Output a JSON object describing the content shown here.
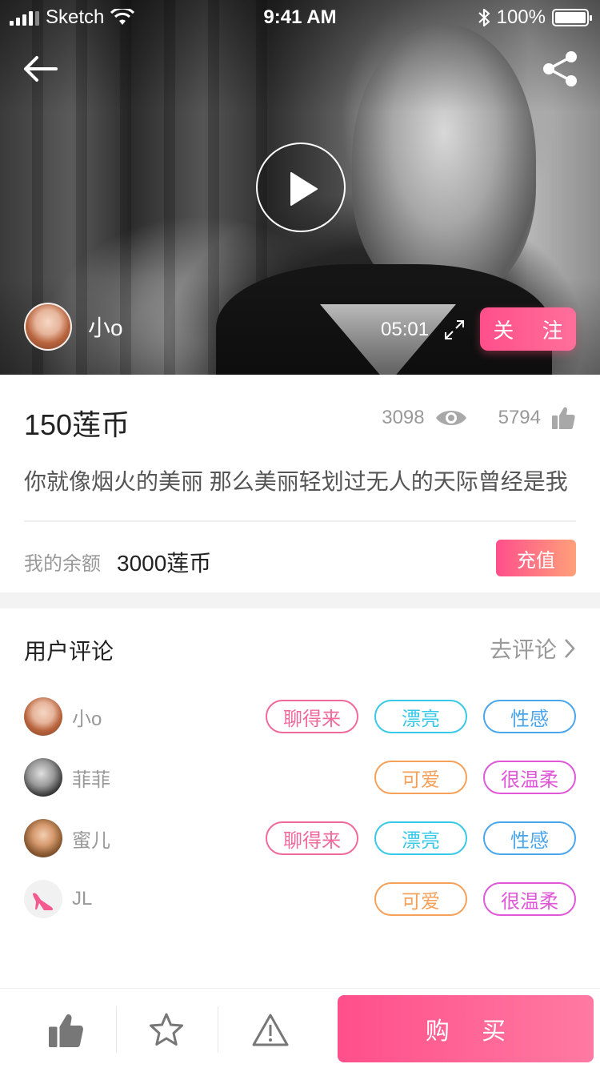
{
  "status_bar": {
    "carrier": "Sketch",
    "time": "9:41 AM",
    "battery_text": "100%"
  },
  "video": {
    "author_name": "小o",
    "duration": "05:01",
    "follow_label": "关 注"
  },
  "product": {
    "price": "150莲币",
    "views": "3098",
    "likes": "5794",
    "description": "你就像烟火的美丽 那么美丽轻划过无人的天际曾经是我"
  },
  "balance": {
    "label": "我的余额",
    "value": "3000莲币",
    "recharge_label": "充值"
  },
  "comments": {
    "title": "用户评论",
    "go_comment_label": "去评论",
    "items": [
      {
        "name": "小o",
        "tags": [
          "聊得来",
          "漂亮",
          "性感"
        ]
      },
      {
        "name": "菲菲",
        "tags": [
          "可爱",
          "很温柔"
        ]
      },
      {
        "name": "蜜儿",
        "tags": [
          "聊得来",
          "漂亮",
          "性感"
        ]
      },
      {
        "name": "JL",
        "tags": [
          "可爱",
          "很温柔"
        ]
      }
    ]
  },
  "tag_colors": {
    "聊得来": "#f0699a",
    "漂亮": "#38c8e8",
    "性感": "#4aa6ec",
    "可爱": "#f6a15a",
    "很温柔": "#e058d8"
  },
  "icons": {
    "back": "arrow-left-icon",
    "share": "share-icon",
    "play": "play-icon",
    "fullscreen": "expand-icon",
    "views": "eye-icon",
    "likes": "thumbs-up-icon",
    "favorite": "star-icon",
    "report": "warning-icon",
    "chevron": "chevron-right-icon"
  },
  "bottom_bar": {
    "buy_label": "购 买"
  },
  "colors": {
    "accent": "#ff4f8b",
    "accent_end": "#ffa07a"
  }
}
